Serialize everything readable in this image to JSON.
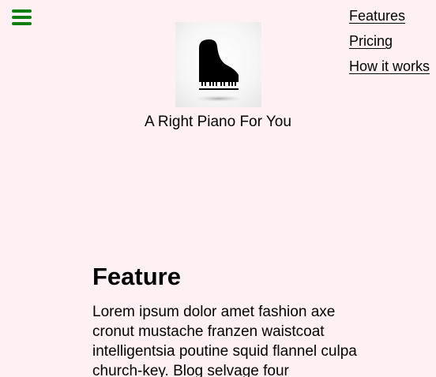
{
  "header": {
    "menu_icon": "hamburger-menu-icon",
    "logo_icon": "grand-piano-icon",
    "tagline": "A Right Piano For You"
  },
  "nav": {
    "items": [
      {
        "label": "Features"
      },
      {
        "label": "Pricing"
      },
      {
        "label": "How it works"
      }
    ]
  },
  "feature": {
    "title": "Feature",
    "text": "Lorem ipsum dolor amet fashion axe cronut mustache franzen waistcoat intelligentsia poutine squid flannel culpa church-key. Blog selvage four"
  },
  "colors": {
    "background": "#fff0f3",
    "menu_icon": "#107d10"
  }
}
